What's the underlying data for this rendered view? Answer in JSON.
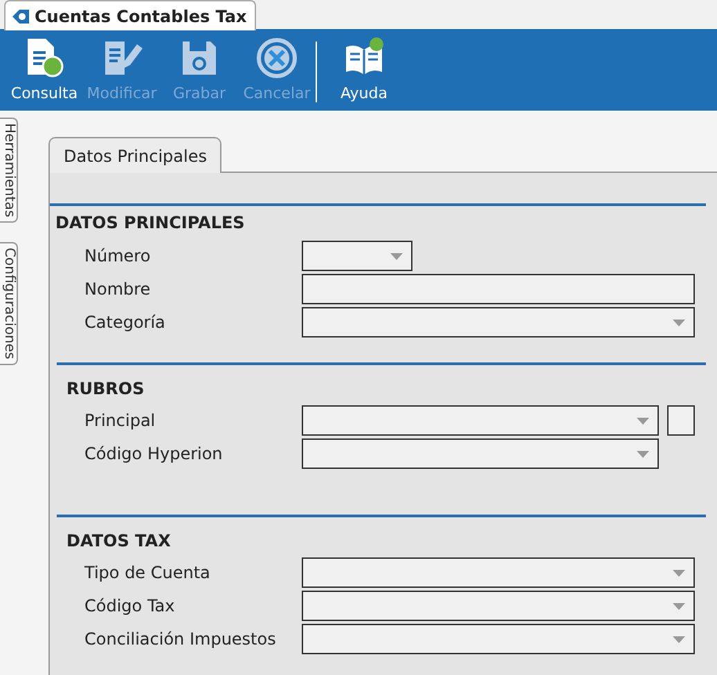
{
  "window": {
    "title": "Cuentas Contables Tax"
  },
  "toolbar": [
    {
      "label": "Consulta",
      "kind": "query",
      "disabled": false
    },
    {
      "label": "Modificar",
      "kind": "edit",
      "disabled": true
    },
    {
      "label": "Grabar",
      "kind": "save",
      "disabled": true
    },
    {
      "label": "Cancelar",
      "kind": "cancel",
      "disabled": true
    },
    {
      "label": "Ayuda",
      "kind": "help",
      "disabled": false
    }
  ],
  "side_tabs": [
    "Herramientas",
    "Configuraciones"
  ],
  "tabs": [
    {
      "label": "Datos Principales",
      "selected": true
    }
  ],
  "sections": [
    {
      "title": "DATOS PRINCIPALES",
      "fields": [
        {
          "label": "Número",
          "kind": "short_combo"
        },
        {
          "label": "Nombre",
          "kind": "text"
        },
        {
          "label": "Categoría",
          "kind": "combo"
        }
      ]
    },
    {
      "title": "RUBROS",
      "fields": [
        {
          "label": "Principal",
          "kind": "combo",
          "extra_box": true
        },
        {
          "label": "Código Hyperion",
          "kind": "combo"
        }
      ]
    },
    {
      "title": "DATOS TAX",
      "fields": [
        {
          "label": "Tipo de Cuenta",
          "kind": "combo"
        },
        {
          "label": "Código Tax",
          "kind": "combo"
        },
        {
          "label": "Conciliación Impuestos",
          "kind": "combo"
        }
      ]
    }
  ]
}
